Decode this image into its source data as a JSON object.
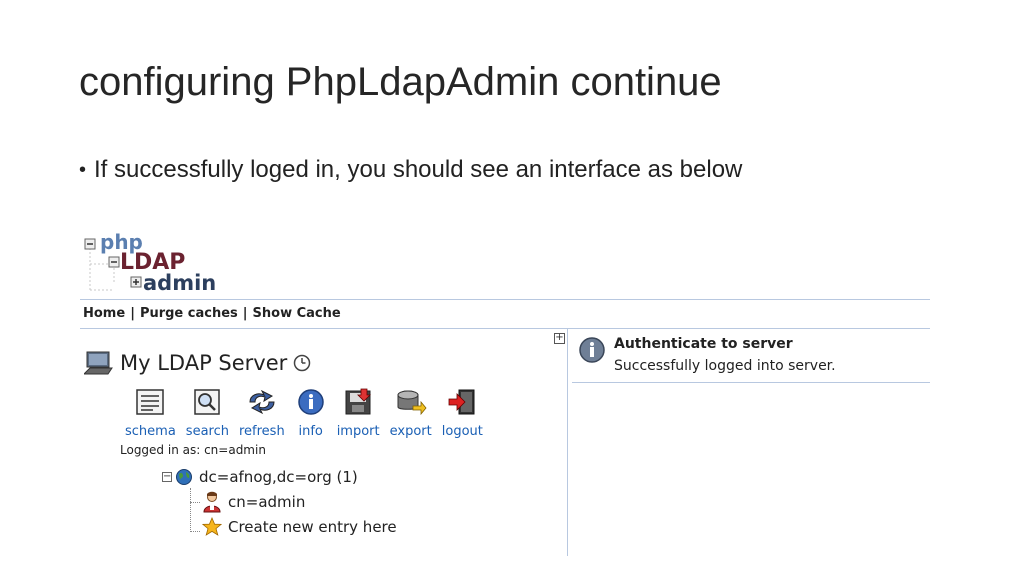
{
  "slide": {
    "title": "configuring PhpLdapAdmin continue",
    "bullet": "If successfully loged in, you should see an interface as below"
  },
  "pla": {
    "logo": {
      "php": "php",
      "ldap": "LDAP",
      "admin": "admin"
    },
    "menu": {
      "home": "Home",
      "sep": "|",
      "purge": "Purge caches",
      "show_cache": "Show Cache"
    },
    "expand_glyph": "+",
    "server": {
      "name": "My LDAP Server"
    },
    "toolbar": [
      {
        "label": "schema",
        "icon": "schema-icon"
      },
      {
        "label": "search",
        "icon": "search-icon"
      },
      {
        "label": "refresh",
        "icon": "refresh-icon"
      },
      {
        "label": "info",
        "icon": "info-icon"
      },
      {
        "label": "import",
        "icon": "import-icon"
      },
      {
        "label": "export",
        "icon": "export-icon"
      },
      {
        "label": "logout",
        "icon": "logout-icon"
      }
    ],
    "logged_in": "Logged in as: cn=admin",
    "tree": {
      "collapse_glyph": "−",
      "root": "dc=afnog,dc=org (1)",
      "children": [
        {
          "label": "cn=admin",
          "icon": "user-icon"
        },
        {
          "label": "Create new entry here",
          "icon": "star-icon"
        }
      ]
    },
    "auth": {
      "title": "Authenticate to server",
      "message": "Successfully logged into server."
    }
  }
}
